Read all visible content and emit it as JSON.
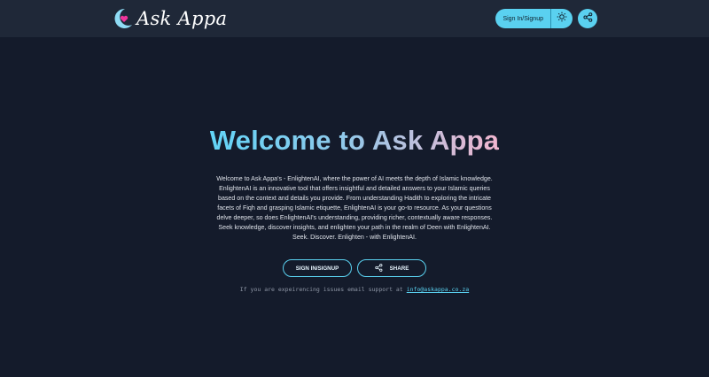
{
  "header": {
    "logo_text": "Ask Appa",
    "signin_label": "Sign In/Signup",
    "icons": [
      "moon-heart-logo-icon",
      "sun-icon",
      "share-icon"
    ]
  },
  "hero": {
    "title": "Welcome to Ask Appa",
    "intro": "Welcome to Ask Appa's - EnlightenAI, where the power of AI meets the depth of Islamic knowledge. EnlightenAI is an innovative tool that offers insightful and detailed answers to your Islamic queries based on the context and details you provide. From understanding Hadith to exploring the intricate facets of Fiqh and grasping Islamic etiquette, EnlightenAI is your go-to resource. As your questions delve deeper, so does EnlightenAI's understanding, providing richer, contextually aware responses. Seek knowledge, discover insights, and enlighten your path in the realm of Deen with EnlightenAI. Seek. Discover. Enlighten - with EnlightenAI."
  },
  "actions": {
    "signin_label": "SIGN IN/SIGNUP",
    "share_label": "SHARE"
  },
  "support": {
    "text": "If you are expeirencing issues email support at",
    "email": "info@askappa.co.za"
  },
  "colors": {
    "background": "#141b2b",
    "header": "#1f2838",
    "accent": "#5ad1f0",
    "title_gradient_end": "#f2b6cf"
  }
}
